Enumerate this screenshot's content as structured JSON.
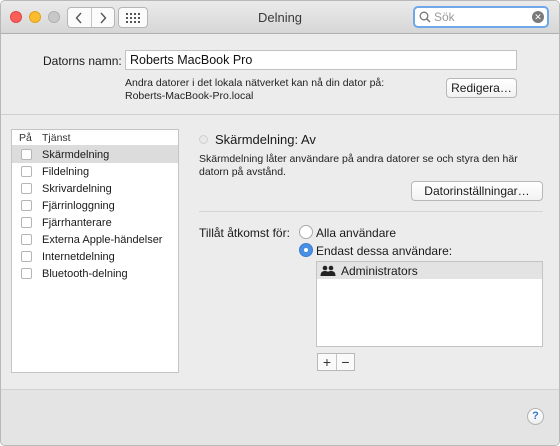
{
  "window": {
    "title": "Delning"
  },
  "toolbar": {
    "back_icon": "chevron-left-icon",
    "forward_icon": "chevron-right-icon",
    "grid_icon": "grid-icon"
  },
  "search": {
    "placeholder": "Sök",
    "value": ""
  },
  "computer_name": {
    "label": "Datorns namn:",
    "value": "Roberts MacBook Pro",
    "description_line1": "Andra datorer i det lokala nätverket kan nå din dator på:",
    "description_line2": "Roberts-MacBook-Pro.local",
    "edit_button": "Redigera…"
  },
  "services": {
    "header_on": "På",
    "header_service": "Tjänst",
    "items": [
      {
        "label": "Skärmdelning",
        "checked": false,
        "selected": true
      },
      {
        "label": "Fildelning",
        "checked": false,
        "selected": false
      },
      {
        "label": "Skrivardelning",
        "checked": false,
        "selected": false
      },
      {
        "label": "Fjärrinloggning",
        "checked": false,
        "selected": false
      },
      {
        "label": "Fjärrhanterare",
        "checked": false,
        "selected": false
      },
      {
        "label": "Externa Apple-händelser",
        "checked": false,
        "selected": false
      },
      {
        "label": "Internetdelning",
        "checked": false,
        "selected": false
      },
      {
        "label": "Bluetooth-delning",
        "checked": false,
        "selected": false
      }
    ]
  },
  "detail": {
    "status": "Skärmdelning: Av",
    "description": "Skärmdelning låter användare på andra datorer se och styra den här datorn på avstånd.",
    "computer_settings_button": "Datorinställningar…",
    "access_label": "Tillåt åtkomst för:",
    "radio_all": "Alla användare",
    "radio_only": "Endast dessa användare:",
    "selected_radio": "only",
    "users": [
      "Administrators"
    ],
    "add_button": "+",
    "remove_button": "−"
  },
  "help": {
    "label": "?"
  },
  "colors": {
    "accent": "#4a90e2",
    "close": "#fc5f57",
    "minimize": "#fdbc2e",
    "zoom": "#c8c8c8"
  }
}
